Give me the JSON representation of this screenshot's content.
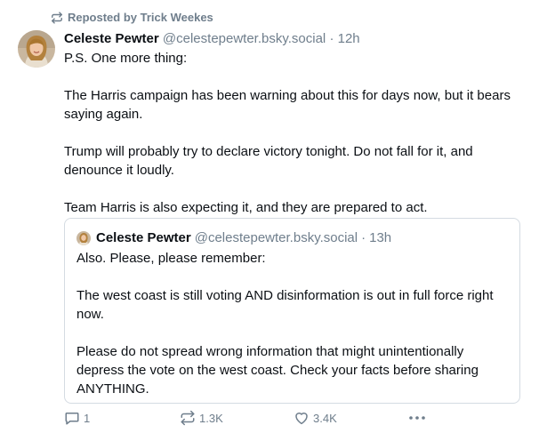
{
  "repost": {
    "icon": "repost-icon",
    "label": "Reposted by Trick Weekes"
  },
  "post": {
    "author_name": "Celeste Pewter",
    "handle": "@celestepewter.bsky.social",
    "separator": "·",
    "time": "12h",
    "paragraphs": [
      "P.S. One more thing:",
      "The Harris campaign has been warning about this for days now, but it bears saying again.",
      "Trump will probably try to declare victory tonight. Do not fall for it, and denounce it loudly.",
      "Team Harris is also expecting it, and they are prepared to act."
    ]
  },
  "quote": {
    "author_name": "Celeste Pewter",
    "handle": "@celestepewter.bsky.social",
    "separator": "·",
    "time": "13h",
    "paragraphs": [
      "Also. Please, please remember:",
      "The west coast is still voting AND disinformation is out in full force right now.",
      "Please do not spread wrong information that might unintentionally depress the vote on the west coast. Check your facts before sharing ANYTHING."
    ]
  },
  "actions": {
    "reply_count": "1",
    "repost_count": "1.3K",
    "like_count": "3.4K",
    "icons": [
      "reply-icon",
      "repost-icon",
      "heart-icon",
      "more-icon"
    ]
  },
  "colors": {
    "text": "#0b0f14",
    "muted": "#6f7e8c",
    "border": "#d4dbe2",
    "background": "#ffffff"
  }
}
